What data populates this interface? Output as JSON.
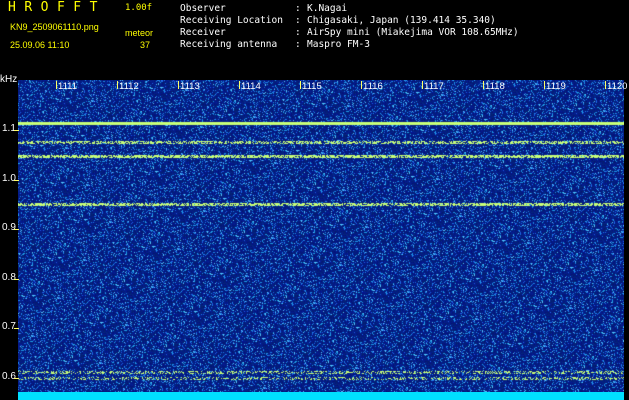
{
  "header": {
    "app_title": "HROFFT",
    "version": "1.00f",
    "filename": "KN9_2509061110.png",
    "datetime": "25.09.06 11:10",
    "counter_label": "meteor",
    "counter_value": "37",
    "info": [
      {
        "label": "Observer",
        "value": "K.Nagai"
      },
      {
        "label": "Receiving Location",
        "value": "Chigasaki, Japan (139.414 35.340)"
      },
      {
        "label": "Receiver",
        "value": "AirSpy mini (Miakejima VOR 108.65MHz)"
      },
      {
        "label": "Receiving antenna",
        "value": "Maspro FM-3"
      }
    ]
  },
  "spectrogram": {
    "y_unit": "kHz",
    "y_ticks": [
      "1.1",
      "1.0",
      "0.9",
      "0.8",
      "0.7",
      "0.6"
    ],
    "x_ticks": [
      "1111",
      "1112",
      "1113",
      "1114",
      "1115",
      "1116",
      "1117",
      "1118",
      "1119",
      "1120"
    ],
    "colors": {
      "background": "#061a8a",
      "noise": "#2a7cff",
      "signal": "#d0ff60",
      "bottom_bar": "#00e0ff"
    }
  }
}
